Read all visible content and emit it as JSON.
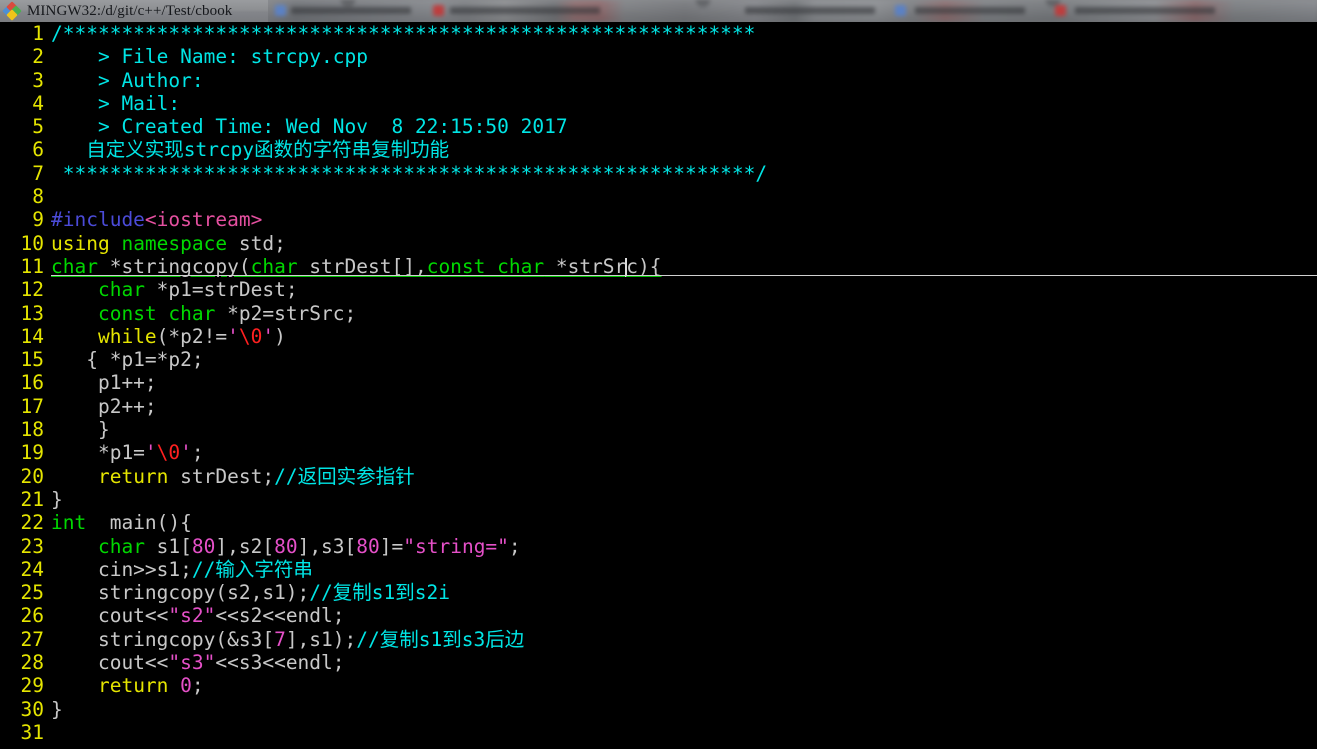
{
  "window": {
    "title": "MINGW32:/d/git/c++/Test/cbook",
    "icon": "mingw-diamond-icon"
  },
  "editor": {
    "app": "vim",
    "cursor_line": 11,
    "cursor_column": 68,
    "colors": {
      "background": "#000000",
      "line_number": "#e5e500",
      "comment": "#00e5e5",
      "type": "#00d800",
      "statement": "#e5e500",
      "constant": "#e550c8",
      "preproc": "#4b4bd8",
      "include_path": "#e550a0",
      "special_escape": "#ff2020",
      "normal_text": "#c8c8c8",
      "cursorline_underline": "#d0d0d0"
    },
    "lines": [
      {
        "n": "1",
        "tokens": [
          {
            "t": "comment",
            "s": "/***********************************************************"
          }
        ]
      },
      {
        "n": "2",
        "tokens": [
          {
            "t": "comment",
            "s": "    > File Name: strcpy.cpp"
          }
        ]
      },
      {
        "n": "3",
        "tokens": [
          {
            "t": "comment",
            "s": "    > Author:"
          }
        ]
      },
      {
        "n": "4",
        "tokens": [
          {
            "t": "comment",
            "s": "    > Mail:"
          }
        ]
      },
      {
        "n": "5",
        "tokens": [
          {
            "t": "comment",
            "s": "    > Created Time: Wed Nov  8 22:15:50 2017"
          }
        ]
      },
      {
        "n": "6",
        "tokens": [
          {
            "t": "comment",
            "s": "   自定义实现strcpy函数的字符串复制功能"
          }
        ]
      },
      {
        "n": "7",
        "tokens": [
          {
            "t": "comment",
            "s": " ***********************************************************/"
          }
        ]
      },
      {
        "n": "8",
        "tokens": []
      },
      {
        "n": "9",
        "tokens": [
          {
            "t": "pre",
            "s": "#include"
          },
          {
            "t": "inc",
            "s": "<iostream>"
          }
        ]
      },
      {
        "n": "10",
        "tokens": [
          {
            "t": "stmt",
            "s": "using"
          },
          {
            "t": "plain",
            "s": " "
          },
          {
            "t": "type",
            "s": "namespace"
          },
          {
            "t": "plain",
            "s": " std;"
          }
        ]
      },
      {
        "n": "11",
        "tokens": [
          {
            "t": "type",
            "s": "char"
          },
          {
            "t": "plain",
            "s": " *stringcopy("
          },
          {
            "t": "type",
            "s": "char"
          },
          {
            "t": "plain",
            "s": " strDest[],"
          },
          {
            "t": "type",
            "s": "const char"
          },
          {
            "t": "plain",
            "s": " *strSr"
          },
          {
            "t": "caret",
            "s": ""
          },
          {
            "t": "plain",
            "s": "c){"
          }
        ]
      },
      {
        "n": "12",
        "tokens": [
          {
            "t": "plain",
            "s": "    "
          },
          {
            "t": "type",
            "s": "char"
          },
          {
            "t": "plain",
            "s": " *p1=strDest;"
          }
        ]
      },
      {
        "n": "13",
        "tokens": [
          {
            "t": "plain",
            "s": "    "
          },
          {
            "t": "type",
            "s": "const char"
          },
          {
            "t": "plain",
            "s": " *p2=strSrc;"
          }
        ]
      },
      {
        "n": "14",
        "tokens": [
          {
            "t": "plain",
            "s": "    "
          },
          {
            "t": "stmt",
            "s": "while"
          },
          {
            "t": "plain",
            "s": "(*p2!="
          },
          {
            "t": "const",
            "s": "'"
          },
          {
            "t": "esc",
            "s": "\\0"
          },
          {
            "t": "const",
            "s": "'"
          },
          {
            "t": "plain",
            "s": ")"
          }
        ]
      },
      {
        "n": "15",
        "tokens": [
          {
            "t": "plain",
            "s": "   { *p1=*p2;"
          }
        ]
      },
      {
        "n": "16",
        "tokens": [
          {
            "t": "plain",
            "s": "    p1++;"
          }
        ]
      },
      {
        "n": "17",
        "tokens": [
          {
            "t": "plain",
            "s": "    p2++;"
          }
        ]
      },
      {
        "n": "18",
        "tokens": [
          {
            "t": "plain",
            "s": "    }"
          }
        ]
      },
      {
        "n": "19",
        "tokens": [
          {
            "t": "plain",
            "s": "    *p1="
          },
          {
            "t": "const",
            "s": "'"
          },
          {
            "t": "esc",
            "s": "\\0"
          },
          {
            "t": "const",
            "s": "'"
          },
          {
            "t": "plain",
            "s": ";"
          }
        ]
      },
      {
        "n": "20",
        "tokens": [
          {
            "t": "plain",
            "s": "    "
          },
          {
            "t": "stmt",
            "s": "return"
          },
          {
            "t": "plain",
            "s": " strDest;"
          },
          {
            "t": "comment",
            "s": "//返回实参指针"
          }
        ]
      },
      {
        "n": "21",
        "tokens": [
          {
            "t": "plain",
            "s": "}"
          }
        ]
      },
      {
        "n": "22",
        "tokens": [
          {
            "t": "type",
            "s": "int"
          },
          {
            "t": "plain",
            "s": "  main(){"
          }
        ]
      },
      {
        "n": "23",
        "tokens": [
          {
            "t": "plain",
            "s": "    "
          },
          {
            "t": "type",
            "s": "char"
          },
          {
            "t": "plain",
            "s": " s1["
          },
          {
            "t": "const",
            "s": "80"
          },
          {
            "t": "plain",
            "s": "],s2["
          },
          {
            "t": "const",
            "s": "80"
          },
          {
            "t": "plain",
            "s": "],s3["
          },
          {
            "t": "const",
            "s": "80"
          },
          {
            "t": "plain",
            "s": "]="
          },
          {
            "t": "string",
            "s": "\"string=\""
          },
          {
            "t": "plain",
            "s": ";"
          }
        ]
      },
      {
        "n": "24",
        "tokens": [
          {
            "t": "plain",
            "s": "    cin>>s1;"
          },
          {
            "t": "comment",
            "s": "//输入字符串"
          }
        ]
      },
      {
        "n": "25",
        "tokens": [
          {
            "t": "plain",
            "s": "    stringcopy(s2,s1);"
          },
          {
            "t": "comment",
            "s": "//复制s1到s2i"
          }
        ]
      },
      {
        "n": "26",
        "tokens": [
          {
            "t": "plain",
            "s": "    cout<<"
          },
          {
            "t": "string",
            "s": "\"s2\""
          },
          {
            "t": "plain",
            "s": "<<s2<<endl;"
          }
        ]
      },
      {
        "n": "27",
        "tokens": [
          {
            "t": "plain",
            "s": "    stringcopy(&s3["
          },
          {
            "t": "const",
            "s": "7"
          },
          {
            "t": "plain",
            "s": "],s1);"
          },
          {
            "t": "comment",
            "s": "//复制s1到s3后边"
          }
        ]
      },
      {
        "n": "28",
        "tokens": [
          {
            "t": "plain",
            "s": "    cout<<"
          },
          {
            "t": "string",
            "s": "\"s3\""
          },
          {
            "t": "plain",
            "s": "<<s3<<endl;"
          }
        ]
      },
      {
        "n": "29",
        "tokens": [
          {
            "t": "plain",
            "s": "    "
          },
          {
            "t": "stmt",
            "s": "return"
          },
          {
            "t": "plain",
            "s": " "
          },
          {
            "t": "const",
            "s": "0"
          },
          {
            "t": "plain",
            "s": ";"
          }
        ]
      },
      {
        "n": "30",
        "tokens": [
          {
            "t": "plain",
            "s": "}"
          }
        ]
      },
      {
        "n": "31",
        "tokens": []
      }
    ]
  }
}
